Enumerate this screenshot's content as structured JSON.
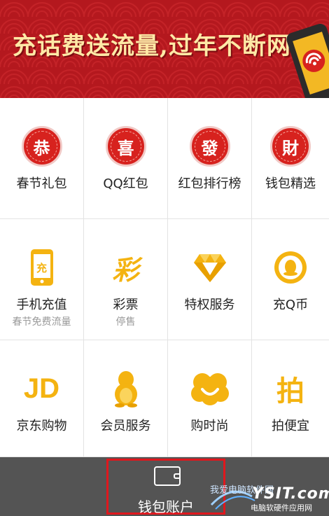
{
  "banner": {
    "title": "充话费送流量,过年不断网",
    "bg_color": "#b4181e",
    "title_color": "#ffe9a6"
  },
  "grid": {
    "items": [
      {
        "name": "spring-gift",
        "label": "春节礼包",
        "glyph": "恭",
        "icon": "gong-red-circle-icon"
      },
      {
        "name": "qq-redpacket",
        "label": "QQ红包",
        "glyph": "喜",
        "icon": "xi-red-circle-icon"
      },
      {
        "name": "redpacket-ranking",
        "label": "红包排行榜",
        "glyph": "發",
        "icon": "fa-red-circle-icon"
      },
      {
        "name": "wallet-picks",
        "label": "钱包精选",
        "glyph": "財",
        "icon": "cai-red-circle-icon"
      },
      {
        "name": "phone-topup",
        "label": "手机充值",
        "sub": "春节免费流量",
        "glyph": "充",
        "icon": "phone-topup-icon"
      },
      {
        "name": "lottery",
        "label": "彩票",
        "sub": "停售",
        "glyph": "彩",
        "icon": "lottery-icon"
      },
      {
        "name": "privileges",
        "label": "特权服务",
        "icon": "diamond-icon"
      },
      {
        "name": "q-coin",
        "label": "充Q币",
        "icon": "q-coin-icon"
      },
      {
        "name": "jd-shopping",
        "label": "京东购物",
        "glyph": "JD",
        "icon": "jd-icon"
      },
      {
        "name": "member",
        "label": "会员服务",
        "icon": "penguin-icon"
      },
      {
        "name": "fashion",
        "label": "购时尚",
        "icon": "smile-flower-icon"
      },
      {
        "name": "auction",
        "label": "拍便宜",
        "glyph": "拍",
        "icon": "pai-icon"
      }
    ],
    "accent_red": "#d7221e",
    "accent_yellow": "#f4b311"
  },
  "bottom_bar": {
    "wallet_label": "钱包账户",
    "bg_color": "#545454",
    "highlight_color": "#e0171d"
  },
  "watermark": {
    "top": "我爱电脑软件网",
    "site": "YSIT.com",
    "sub": "电脑软硬件应用网"
  }
}
